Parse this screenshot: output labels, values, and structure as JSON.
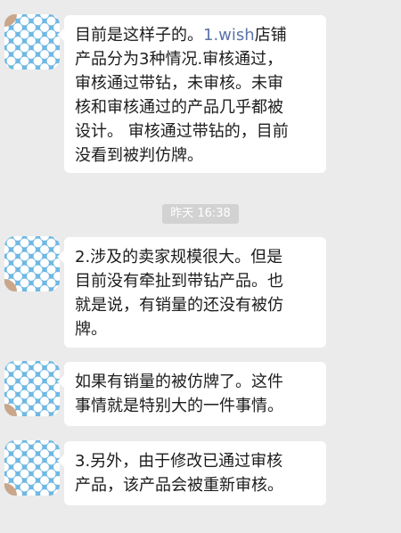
{
  "chat": {
    "messages": [
      {
        "prefix": "目前是这样子的。",
        "link": "1.wish",
        "suffix": "店铺\n产品分为3种情况.审核通过，\n审核通过带钻，未审核。未审\n核和审核通过的产品几乎都被\n设计。 审核通过带钻的，目前\n没看到被判仿牌。"
      },
      {
        "text": "2.涉及的卖家规模很大。但是\n目前没有牵扯到带钻产品。也\n就是说，有销量的还没有被仿\n牌。"
      },
      {
        "text": "如果有销量的被仿牌了。这件\n事情就是特别大的一件事情。"
      },
      {
        "text": "3.另外，由于修改已通过审核\n产品，该产品会被重新审核。"
      }
    ],
    "timestamp": "昨天 16:38"
  },
  "colors": {
    "background": "#ebebeb",
    "bubble": "#ffffff",
    "link": "#5a74a8",
    "timestamp_bg": "#d2d2d2",
    "avatar": "#6fb8e3"
  }
}
